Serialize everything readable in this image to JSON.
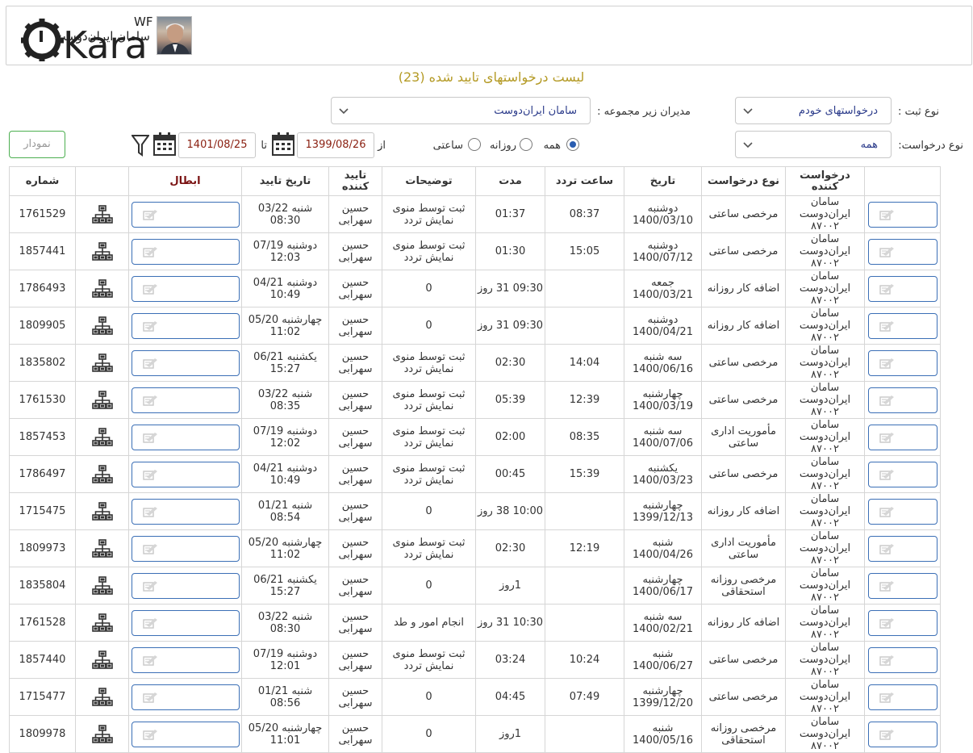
{
  "header": {
    "logo_text": "Kara",
    "logo_superscript": "WF",
    "user_name": "سامان ایران‌دوست"
  },
  "page_title": "لیست درخواستهای تایید شده (23)",
  "filters": {
    "register_type_label": "نوع ثبت :",
    "register_type_value": "درخواستهای خودم",
    "managers_label": "مدیران زیر مجموعه :",
    "managers_value": "سامان ایران‌دوست",
    "request_type_label": "نوع درخواست:",
    "request_type_value": "همه",
    "period_options": [
      "همه",
      "روزانه",
      "ساعتی"
    ],
    "period_selected": "همه",
    "from_label": "از",
    "to_label": "تا",
    "from_date": "1399/08/26",
    "to_date": "1401/08/25",
    "chart_button": "نمودار"
  },
  "table": {
    "columns": [
      "",
      "درخواست کننده",
      "نوع درخواست",
      "تاریخ",
      "ساعت تردد",
      "مدت",
      "توضیحات",
      "تایید کننده",
      "تاریخ تایید",
      "ابطال",
      "",
      "شماره"
    ],
    "rows": [
      {
        "requester": "سامان ایران‌دوست ۸۷۰۰۲",
        "type": "مرخصی ساعتی",
        "date": "دوشنبه 1400/03/10",
        "time": "08:37",
        "duration": "01:37",
        "desc": "ثبت توسط منوی نمایش تردد",
        "approver": "حسین سهرابی",
        "approve_date": "شنبه 03/22 08:30",
        "number": "1761529"
      },
      {
        "requester": "سامان ایران‌دوست ۸۷۰۰۲",
        "type": "مرخصی ساعتی",
        "date": "دوشنبه 1400/07/12",
        "time": "15:05",
        "duration": "01:30",
        "desc": "ثبت توسط منوی نمایش تردد",
        "approver": "حسین سهرابی",
        "approve_date": "دوشنبه 07/19 12:03",
        "number": "1857441"
      },
      {
        "requester": "سامان ایران‌دوست ۸۷۰۰۲",
        "type": "اضافه کار روزانه",
        "date": "جمعه 1400/03/21",
        "time": "",
        "duration": "09:30 31 روز",
        "desc": "0",
        "approver": "حسین سهرابی",
        "approve_date": "دوشنبه 04/21 10:49",
        "number": "1786493"
      },
      {
        "requester": "سامان ایران‌دوست ۸۷۰۰۲",
        "type": "اضافه کار روزانه",
        "date": "دوشنبه 1400/04/21",
        "time": "",
        "duration": "09:30 31 روز",
        "desc": "0",
        "approver": "حسین سهرابی",
        "approve_date": "چهارشنبه 05/20 11:02",
        "number": "1809905"
      },
      {
        "requester": "سامان ایران‌دوست ۸۷۰۰۲",
        "type": "مرخصی ساعتی",
        "date": "سه شنبه 1400/06/16",
        "time": "14:04",
        "duration": "02:30",
        "desc": "ثبت توسط منوی نمایش تردد",
        "approver": "حسین سهرابی",
        "approve_date": "یکشنبه 06/21 15:27",
        "number": "1835802"
      },
      {
        "requester": "سامان ایران‌دوست ۸۷۰۰۲",
        "type": "مرخصی ساعتی",
        "date": "چهارشنبه 1400/03/19",
        "time": "12:39",
        "duration": "05:39",
        "desc": "ثبت توسط منوی نمایش تردد",
        "approver": "حسین سهرابی",
        "approve_date": "شنبه 03/22 08:35",
        "number": "1761530"
      },
      {
        "requester": "سامان ایران‌دوست ۸۷۰۰۲",
        "type": "مأموریت اداری ساعتی",
        "date": "سه شنبه 1400/07/06",
        "time": "08:35",
        "duration": "02:00",
        "desc": "ثبت توسط منوی نمایش تردد",
        "approver": "حسین سهرابی",
        "approve_date": "دوشنبه 07/19 12:02",
        "number": "1857453"
      },
      {
        "requester": "سامان ایران‌دوست ۸۷۰۰۲",
        "type": "مرخصی ساعتی",
        "date": "یکشنبه 1400/03/23",
        "time": "15:39",
        "duration": "00:45",
        "desc": "ثبت توسط منوی نمایش تردد",
        "approver": "حسین سهرابی",
        "approve_date": "دوشنبه 04/21 10:49",
        "number": "1786497"
      },
      {
        "requester": "سامان ایران‌دوست ۸۷۰۰۲",
        "type": "اضافه کار روزانه",
        "date": "چهارشنبه 1399/12/13",
        "time": "",
        "duration": "10:00 38 روز",
        "desc": "0",
        "approver": "حسین سهرابی",
        "approve_date": "شنبه 01/21 08:54",
        "number": "1715475"
      },
      {
        "requester": "سامان ایران‌دوست ۸۷۰۰۲",
        "type": "مأموریت اداری ساعتی",
        "date": "شنبه 1400/04/26",
        "time": "12:19",
        "duration": "02:30",
        "desc": "ثبت توسط منوی نمایش تردد",
        "approver": "حسین سهرابی",
        "approve_date": "چهارشنبه 05/20 11:02",
        "number": "1809973"
      },
      {
        "requester": "سامان ایران‌دوست ۸۷۰۰۲",
        "type": "مرخصی روزانه استحقاقی",
        "date": "چهارشنبه 1400/06/17",
        "time": "",
        "duration": "1روز",
        "desc": "0",
        "approver": "حسین سهرابی",
        "approve_date": "یکشنبه 06/21 15:27",
        "number": "1835804"
      },
      {
        "requester": "سامان ایران‌دوست ۸۷۰۰۲",
        "type": "اضافه کار روزانه",
        "date": "سه شنبه 1400/02/21",
        "time": "",
        "duration": "10:30 31 روز",
        "desc": "انجام امور و طد",
        "approver": "حسین سهرابی",
        "approve_date": "شنبه 03/22 08:30",
        "number": "1761528"
      },
      {
        "requester": "سامان ایران‌دوست ۸۷۰۰۲",
        "type": "مرخصی ساعتی",
        "date": "شنبه 1400/06/27",
        "time": "10:24",
        "duration": "03:24",
        "desc": "ثبت توسط منوی نمایش تردد",
        "approver": "حسین سهرابی",
        "approve_date": "دوشنبه 07/19 12:01",
        "number": "1857440"
      },
      {
        "requester": "سامان ایران‌دوست ۸۷۰۰۲",
        "type": "مرخصی ساعتی",
        "date": "چهارشنبه 1399/12/20",
        "time": "07:49",
        "duration": "04:45",
        "desc": "0",
        "approver": "حسین سهرابی",
        "approve_date": "شنبه 01/21 08:56",
        "number": "1715477"
      },
      {
        "requester": "سامان ایران‌دوست ۸۷۰۰۲",
        "type": "مرخصی روزانه استحقاقی",
        "date": "شنبه 1400/05/16",
        "time": "",
        "duration": "1روز",
        "desc": "0",
        "approver": "حسین سهرابی",
        "approve_date": "چهارشنبه 05/20 11:01",
        "number": "1809978"
      }
    ]
  },
  "colors": {
    "title": "#b49a25",
    "cancel_header": "#7a1212",
    "date_text": "#8a1f10",
    "select_text": "#2a3a8a",
    "button_border": "#3b6fb6",
    "chart_button_border": "#4caf50"
  },
  "icons": {
    "action_icon": "edit-document-icon",
    "org_icon": "hierarchy-icon",
    "calendar_icon": "calendar-icon",
    "filter_icon": "filter-icon",
    "chevron_icon": "chevron-down-icon"
  }
}
